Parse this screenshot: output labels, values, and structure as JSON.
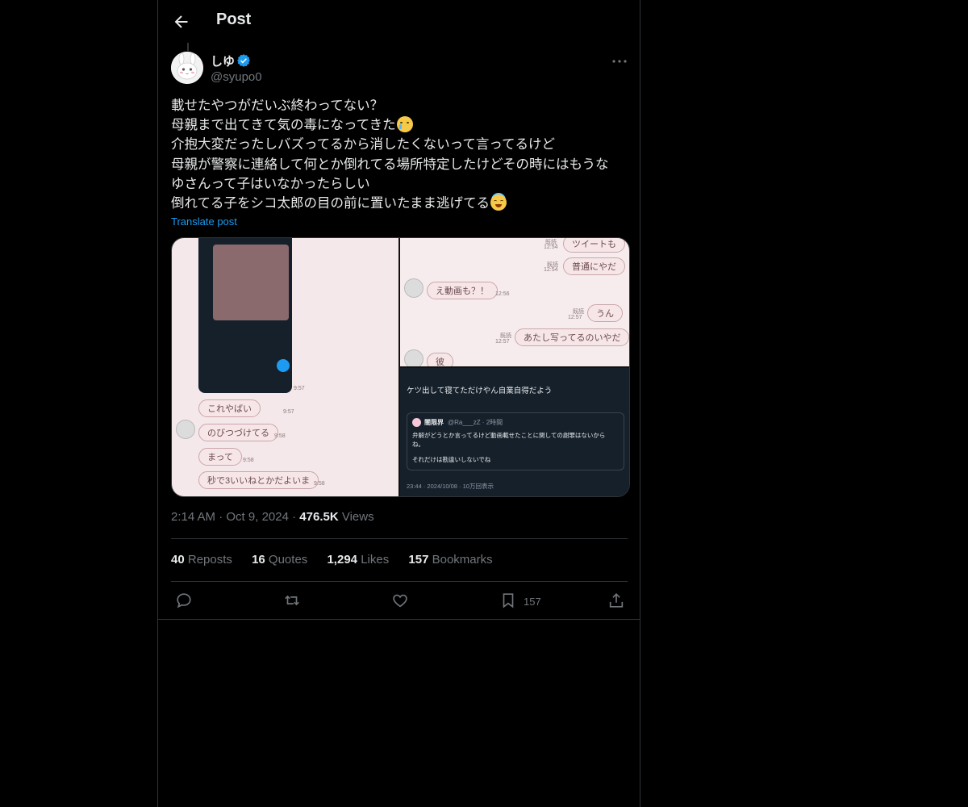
{
  "header": {
    "title": "Post"
  },
  "author": {
    "name": "しゆ",
    "handle": "@syupo0"
  },
  "tweet": {
    "lines": [
      "載せたやつがだいぶ終わってない？",
      "母親まで出てきて気の毒になってきた",
      "介抱大変だったしバズってるから消したくないって言ってるけど",
      "母親が警察に連絡して何とか倒れてる場所特定したけどその時にはもうな",
      "ゆさんって子はいなかったらしい",
      "倒れてる子をシコ太郎の目の前に置いたまま逃げてる"
    ],
    "translate": "Translate post"
  },
  "media": {
    "img1": {
      "bubbles": [
        "これやばい",
        "のびつづけてる",
        "まって",
        "秒で3いいねとかだよいま"
      ],
      "times": [
        "9:57",
        "9:57",
        "9:58",
        "9:58",
        "9:58"
      ]
    },
    "img2": {
      "bubbles": [
        "ツイートも",
        "普通にやだ",
        "え動画も？！",
        "うん",
        "あたし写ってるのいやだ",
        "彼"
      ],
      "times": [
        "12:54",
        "12:54",
        "12:56",
        "12:57",
        "12:57"
      ],
      "read": [
        "既読",
        "既読",
        "既読",
        "既読"
      ]
    },
    "img3": {
      "tweet": "ケツ出して寝てただけやん自業自得だよう",
      "quote_name": "闇限界",
      "quote_handle": "@Ra___zZ · 2時間",
      "quote_line1": "弁解がどうとか言ってるけど動画載せたことに関しての謝罪はないから",
      "quote_line2": "ね。",
      "quote_line3": "それだけは勘違いしないでね",
      "footer": "23:44 · 2024/10/08 · 10万回表示"
    }
  },
  "meta": {
    "time": "2:14 AM",
    "date": "Oct 9, 2024",
    "views": "476.5K",
    "views_label": "Views"
  },
  "stats": {
    "reposts": "40",
    "reposts_label": "Reposts",
    "quotes": "16",
    "quotes_label": "Quotes",
    "likes": "1,294",
    "likes_label": "Likes",
    "bookmarks": "157",
    "bookmarks_label": "Bookmarks"
  },
  "actions": {
    "bookmark_count": "157"
  },
  "colors": {
    "accent": "#1d9bf0",
    "text": "#e7e9ea",
    "muted": "#71767b",
    "border": "#2f3336"
  },
  "icons": [
    "back-arrow-icon",
    "verified-badge-icon",
    "more-icon",
    "reply-icon",
    "repost-icon",
    "like-icon",
    "bookmark-icon",
    "share-icon"
  ]
}
